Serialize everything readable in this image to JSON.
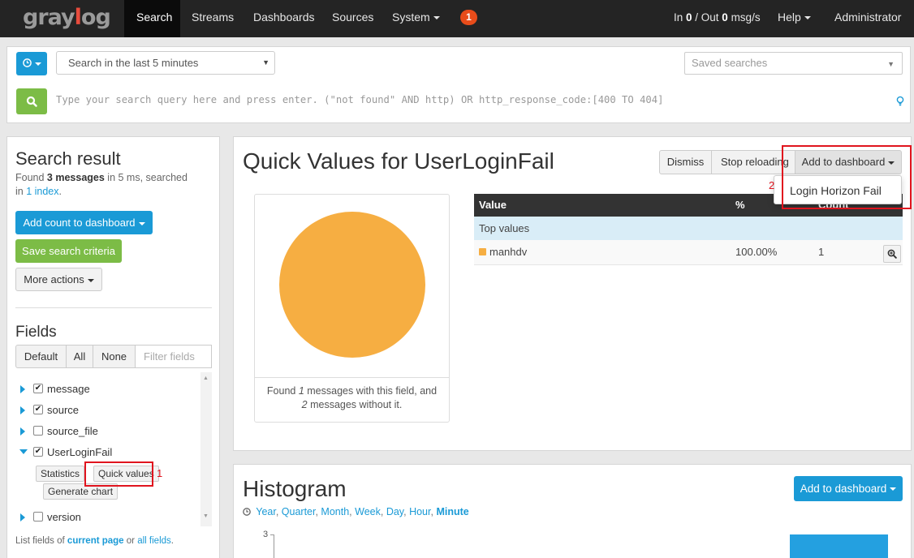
{
  "nav": {
    "logo_pre": "gray",
    "logo_o": "l",
    "logo_post": "og",
    "items": [
      "Search",
      "Streams",
      "Dashboards",
      "Sources",
      "System"
    ],
    "notifications": "1",
    "throughput": {
      "prefix": "In ",
      "in": "0",
      "mid": " / Out ",
      "out": "0",
      "suffix": " msg/s"
    },
    "help": "Help",
    "user": "Administrator"
  },
  "search": {
    "range": "Search in the last 5 minutes",
    "saved_placeholder": "Saved searches",
    "query_placeholder": "Type your search query here and press enter. (\"not found\" AND http) OR http_response_code:[400 TO 404]"
  },
  "sidebar": {
    "title": "Search result",
    "found_pre": "Found ",
    "found_count": "3 messages",
    "found_mid": " in 5 ms, searched",
    "found_in": "in ",
    "index_link": "1 index",
    "found_end": ".",
    "add_count": "Add count to dashboard",
    "save_criteria": "Save search criteria",
    "more_actions": "More actions",
    "fields_title": "Fields",
    "filters": [
      "Default",
      "All",
      "None"
    ],
    "filter_placeholder": "Filter fields",
    "fields": [
      {
        "name": "message",
        "checked": true
      },
      {
        "name": "source",
        "checked": true
      },
      {
        "name": "source_file",
        "checked": false
      },
      {
        "name": "UserLoginFail",
        "checked": true
      },
      {
        "name": "version",
        "checked": false
      }
    ],
    "field_actions": {
      "statistics": "Statistics",
      "quick_values": "Quick values",
      "generate_chart": "Generate chart"
    },
    "annotation_1": "1",
    "list_note": {
      "pre": "List fields of ",
      "current": "current page",
      "mid": " or ",
      "all": "all fields",
      "end": "."
    }
  },
  "quick_values": {
    "title": "Quick Values for UserLoginFail",
    "dismiss": "Dismiss",
    "stop_reloading": "Stop reloading",
    "add_to_dashboard": "Add to dashboard",
    "dropdown_item": "Login Horizon Fail",
    "annotation_2": "2",
    "caption_pre": "Found ",
    "caption_n1": "1",
    "caption_mid": " messages with this field, and",
    "caption_n2": "2",
    "caption_end": " messages without it.",
    "table": {
      "headers": [
        "Value",
        "%",
        "Count"
      ],
      "subheader": "Top values",
      "rows": [
        {
          "value": "manhdv",
          "percent": "100.00%",
          "count": "1",
          "color": "#f6ae42"
        }
      ]
    }
  },
  "histogram": {
    "title": "Histogram",
    "add_to_dashboard": "Add to dashboard",
    "resolutions": [
      "Year",
      "Quarter",
      "Month",
      "Week",
      "Day",
      "Hour",
      "Minute"
    ],
    "active_resolution": "Minute",
    "y_tick": "3"
  },
  "colors": {
    "accent": "#1a9ad6",
    "green": "#7cbc46",
    "pie": "#f6ae42",
    "navbar": "#242424",
    "annotation": "#e0141e"
  }
}
